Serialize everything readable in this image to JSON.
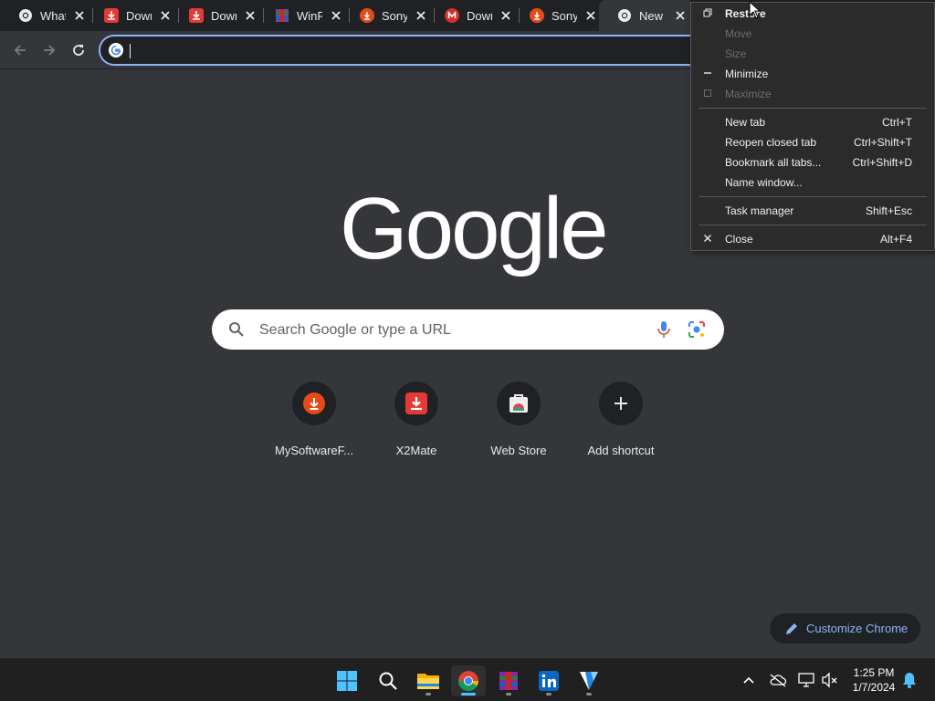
{
  "tabs": [
    {
      "title": "WhatsApp",
      "icon": "chrome-icon"
    },
    {
      "title": "Download",
      "icon": "download-red-icon"
    },
    {
      "title": "Download",
      "icon": "download-red-icon"
    },
    {
      "title": "WinRAR",
      "icon": "winrar-icon"
    },
    {
      "title": "Sony",
      "icon": "download-orange-icon"
    },
    {
      "title": "Download",
      "icon": "mega-icon"
    },
    {
      "title": "Sony",
      "icon": "download-orange-icon"
    },
    {
      "title": "New Tab",
      "icon": "chrome-icon",
      "active": true
    }
  ],
  "omnibox": {
    "value": "",
    "placeholder": ""
  },
  "logo_text": "Google",
  "search": {
    "placeholder": "Search Google or type a URL"
  },
  "shortcuts": [
    {
      "label": "MySoftwareF...",
      "icon": "download-orange-icon"
    },
    {
      "label": "X2Mate",
      "icon": "download-red-icon"
    },
    {
      "label": "Web Store",
      "icon": "webstore-icon"
    },
    {
      "label": "Add shortcut",
      "icon": "plus-icon"
    }
  ],
  "customize_label": "Customize Chrome",
  "system_menu": {
    "restore": "Restore",
    "move": "Move",
    "size": "Size",
    "minimize": "Minimize",
    "maximize": "Maximize",
    "new_tab": "New tab",
    "new_tab_shortcut": "Ctrl+T",
    "reopen": "Reopen closed tab",
    "reopen_shortcut": "Ctrl+Shift+T",
    "bookmark_all": "Bookmark all tabs...",
    "bookmark_all_shortcut": "Ctrl+Shift+D",
    "name_window": "Name window...",
    "task_manager": "Task manager",
    "task_manager_shortcut": "Shift+Esc",
    "close": "Close",
    "close_shortcut": "Alt+F4"
  },
  "taskbar": {
    "apps": [
      "start-icon",
      "search-icon",
      "file-explorer-icon",
      "chrome-icon",
      "winrar-icon",
      "linkedin-icon",
      "app-icon"
    ],
    "time": "1:25 PM",
    "date": "1/7/2024"
  },
  "colors": {
    "accent": "#8ab4f8",
    "background": "#35363a",
    "tabstrip": "#202124"
  }
}
